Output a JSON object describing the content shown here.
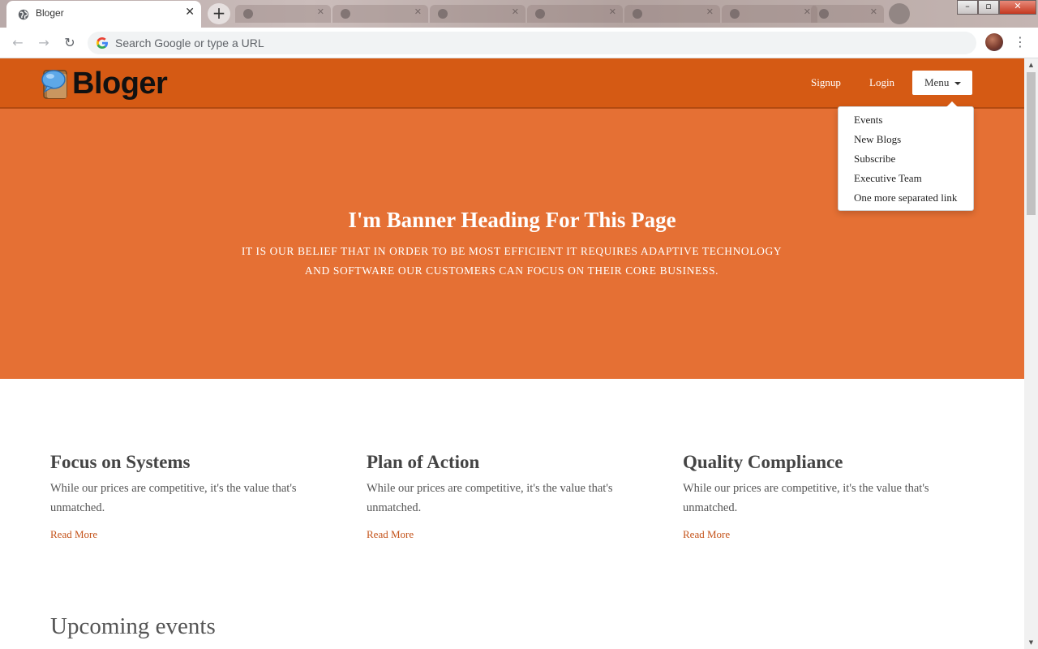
{
  "browser": {
    "active_tab_title": "Bloger",
    "omnibox_placeholder": "Search Google or type a URL",
    "win_min": "–",
    "win_max": "▫",
    "win_close": "✕"
  },
  "site": {
    "logo_text": "Bloger",
    "nav": {
      "signup": "Signup",
      "login": "Login",
      "menu": "Menu"
    },
    "dropdown": [
      "Events",
      "New Blogs",
      "Subscribe",
      "Executive Team",
      "One more separated link"
    ]
  },
  "banner": {
    "heading": "I'm Banner Heading For This Page",
    "subtext": "IT IS OUR BELIEF THAT IN ORDER TO BE MOST EFFICIENT IT REQUIRES ADAPTIVE TECHNOLOGY AND SOFTWARE OUR CUSTOMERS CAN FOCUS ON THEIR CORE BUSINESS."
  },
  "features": [
    {
      "title": "Focus on Systems",
      "text": "While our prices are competitive, it's the value that's unmatched.",
      "link": "Read More"
    },
    {
      "title": "Plan of Action",
      "text": "While our prices are competitive, it's the value that's unmatched.",
      "link": "Read More"
    },
    {
      "title": "Quality Compliance",
      "text": "While our prices are competitive, it's the value that's unmatched.",
      "link": "Read More"
    }
  ],
  "upcoming_heading": "Upcoming events",
  "colors": {
    "nav_bg": "#d55a14",
    "banner_bg": "#e57034",
    "link": "#c4531a"
  }
}
